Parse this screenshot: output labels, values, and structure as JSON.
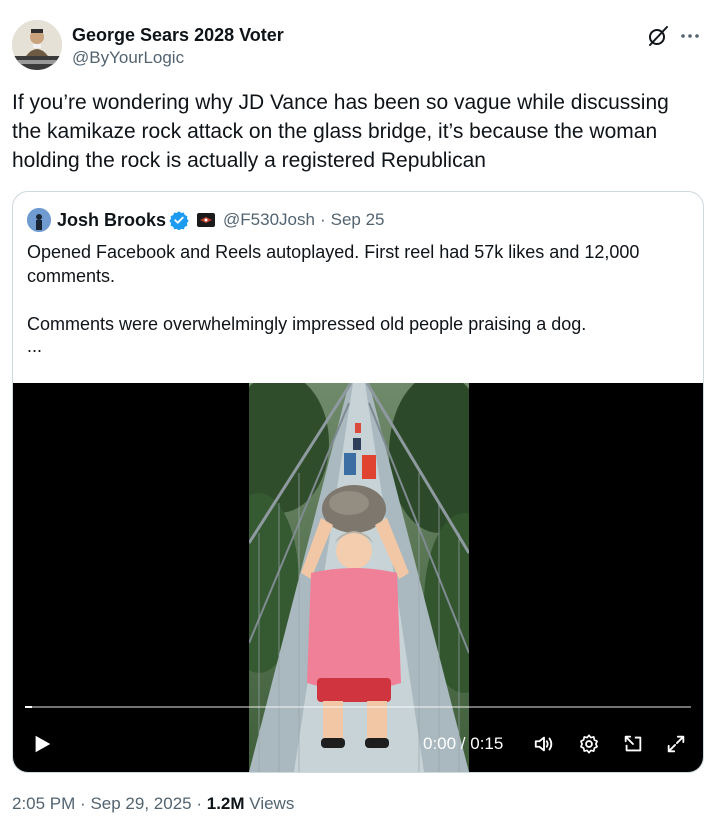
{
  "author": {
    "display_name": "George Sears 2028 Voter",
    "handle": "@ByYourLogic",
    "avatar_icon": "avatar-photo"
  },
  "tweet": {
    "text": "If you’re wondering why JD Vance has been so vague while discussing the kamikaze rock attack on the glass bridge, it’s because the woman holding the rock is actually a registered Republican"
  },
  "quote": {
    "display_name": "Josh Brooks",
    "handle": "@F530Josh",
    "separator": "·",
    "date": "Sep 25",
    "paragraph_1": "Opened Facebook and Reels autoplayed. First reel had 57k likes and 12,000 comments.",
    "paragraph_2": "Comments were overwhelmingly impressed old people praising a dog.",
    "ellipsis": "..."
  },
  "video": {
    "time_display": "0:00 / 0:15",
    "progress_fraction": 0.01,
    "controls": [
      "play-icon",
      "volume-icon",
      "settings-icon",
      "pip-icon",
      "fullscreen-icon"
    ]
  },
  "meta": {
    "time": "2:05 PM",
    "sep": "·",
    "date": "Sep 29, 2025",
    "views_count": "1.2M",
    "views_label": "Views"
  },
  "colors": {
    "text": "#0f1419",
    "secondary": "#536471",
    "border": "#cfd9de",
    "verified": "#1d9bf0"
  }
}
